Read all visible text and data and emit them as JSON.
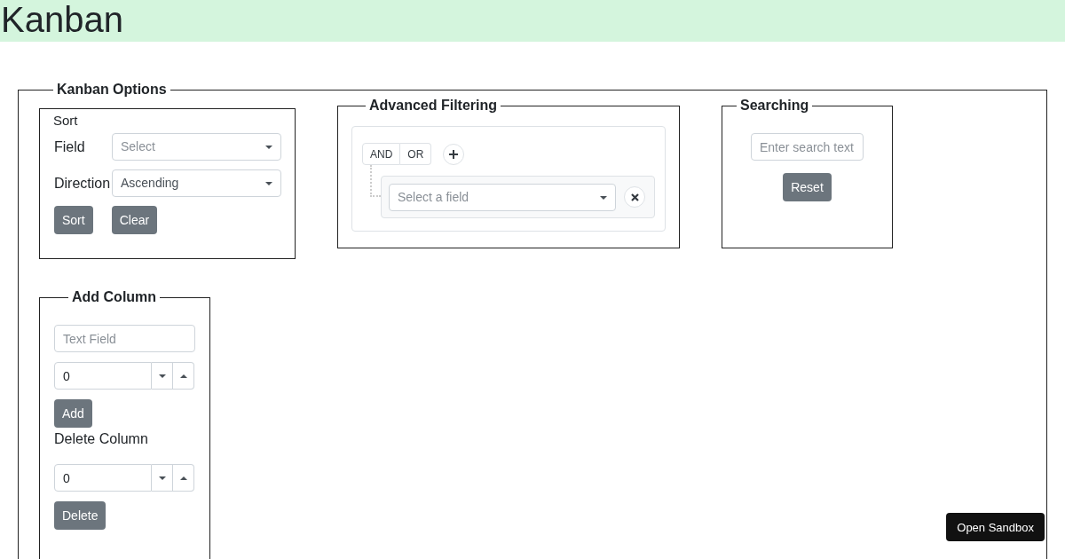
{
  "header": {
    "title": "Kanban"
  },
  "options": {
    "legend": "Kanban Options",
    "sort": {
      "title": "Sort",
      "fields": [
        {
          "label": "Field",
          "placeholder": "Select"
        },
        {
          "label": "Direction",
          "value": "Ascending"
        }
      ],
      "buttons": [
        "Sort",
        "Clear"
      ]
    },
    "filtering": {
      "legend": "Advanced Filtering",
      "operators": [
        {
          "label": "AND",
          "selected": false
        },
        {
          "label": "OR",
          "selected": false
        }
      ],
      "rule": {
        "placeholder": "Select a field"
      }
    },
    "searching": {
      "legend": "Searching",
      "search": {
        "placeholder": "Enter search text"
      },
      "button": "Reset"
    },
    "add_column": {
      "legend": "Add Column",
      "text_field": {
        "placeholder": "Text Field"
      },
      "number": {
        "value": "0"
      },
      "add_button": "Add",
      "delete_label": "Delete Column",
      "delete_number": {
        "value": "0"
      },
      "delete_button": "Delete"
    }
  },
  "sandbox_button": "Open Sandbox"
}
